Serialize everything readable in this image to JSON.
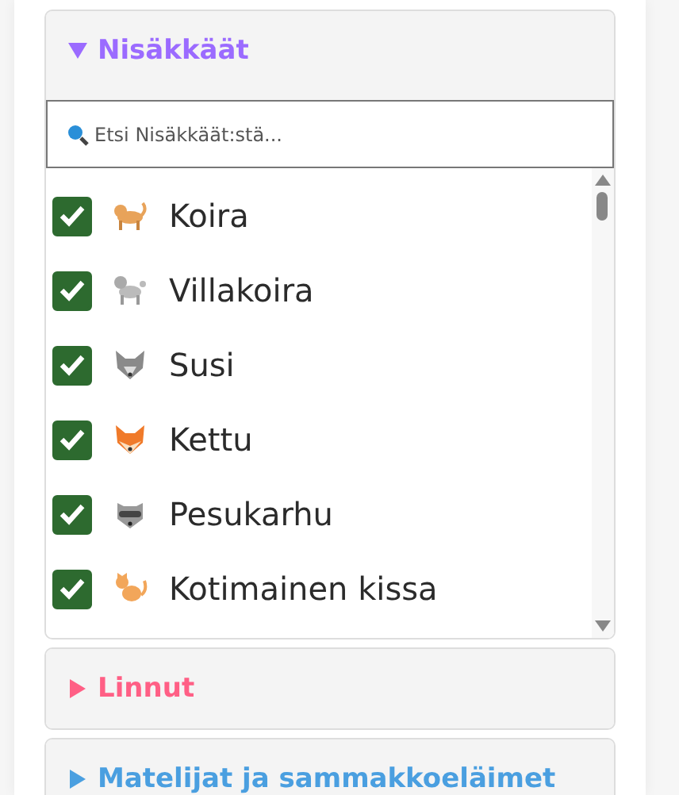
{
  "sections": [
    {
      "title": "Nisäkkäät",
      "color": "#9b6bff",
      "expanded": true,
      "search": {
        "placeholder": "Etsi Nisäkkäät:stä..."
      },
      "items": [
        {
          "label": "Koira",
          "kind": "dog",
          "checked": true
        },
        {
          "label": "Villakoira",
          "kind": "poodle",
          "checked": true
        },
        {
          "label": "Susi",
          "kind": "wolf",
          "checked": true
        },
        {
          "label": "Kettu",
          "kind": "fox",
          "checked": true
        },
        {
          "label": "Pesukarhu",
          "kind": "raccoon",
          "checked": true
        },
        {
          "label": "Kotimainen kissa",
          "kind": "cat",
          "checked": true
        }
      ]
    },
    {
      "title": "Linnut",
      "color": "#ff5f85",
      "expanded": false
    },
    {
      "title": "Matelijat ja sammakkoeläimet",
      "color": "#4a9fe0",
      "expanded": false
    }
  ]
}
